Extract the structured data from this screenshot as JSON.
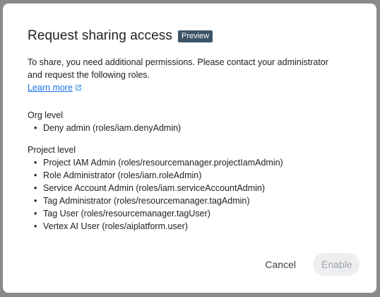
{
  "dialog": {
    "title": "Request sharing access",
    "badge": "Preview",
    "description": "To share, you need additional permissions. Please contact your administrator and request the following roles.",
    "learn_more": "Learn more",
    "org_section": {
      "heading": "Org level",
      "roles": [
        "Deny admin (roles/iam.denyAdmin)"
      ]
    },
    "project_section": {
      "heading": "Project level",
      "roles": [
        "Project IAM Admin (roles/resourcemanager.projectIamAdmin)",
        "Role Administrator (roles/iam.roleAdmin)",
        "Service Account Admin (roles/iam.serviceAccountAdmin)",
        "Tag Administrator (roles/resourcemanager.tagAdmin)",
        "Tag User (roles/resourcemanager.tagUser)",
        "Vertex AI User (roles/aiplatform.user)"
      ]
    },
    "cancel_label": "Cancel",
    "enable_label": "Enable",
    "enable_disabled": true
  },
  "colors": {
    "link": "#1a73e8",
    "badge_bg": "#3c5466",
    "disabled_button_bg": "#eceef0",
    "disabled_button_text": "#a0a4a8",
    "scrim": "#8a8a8a"
  },
  "icons": {
    "learn_more": "open-in-new-icon",
    "bullet": "•"
  }
}
